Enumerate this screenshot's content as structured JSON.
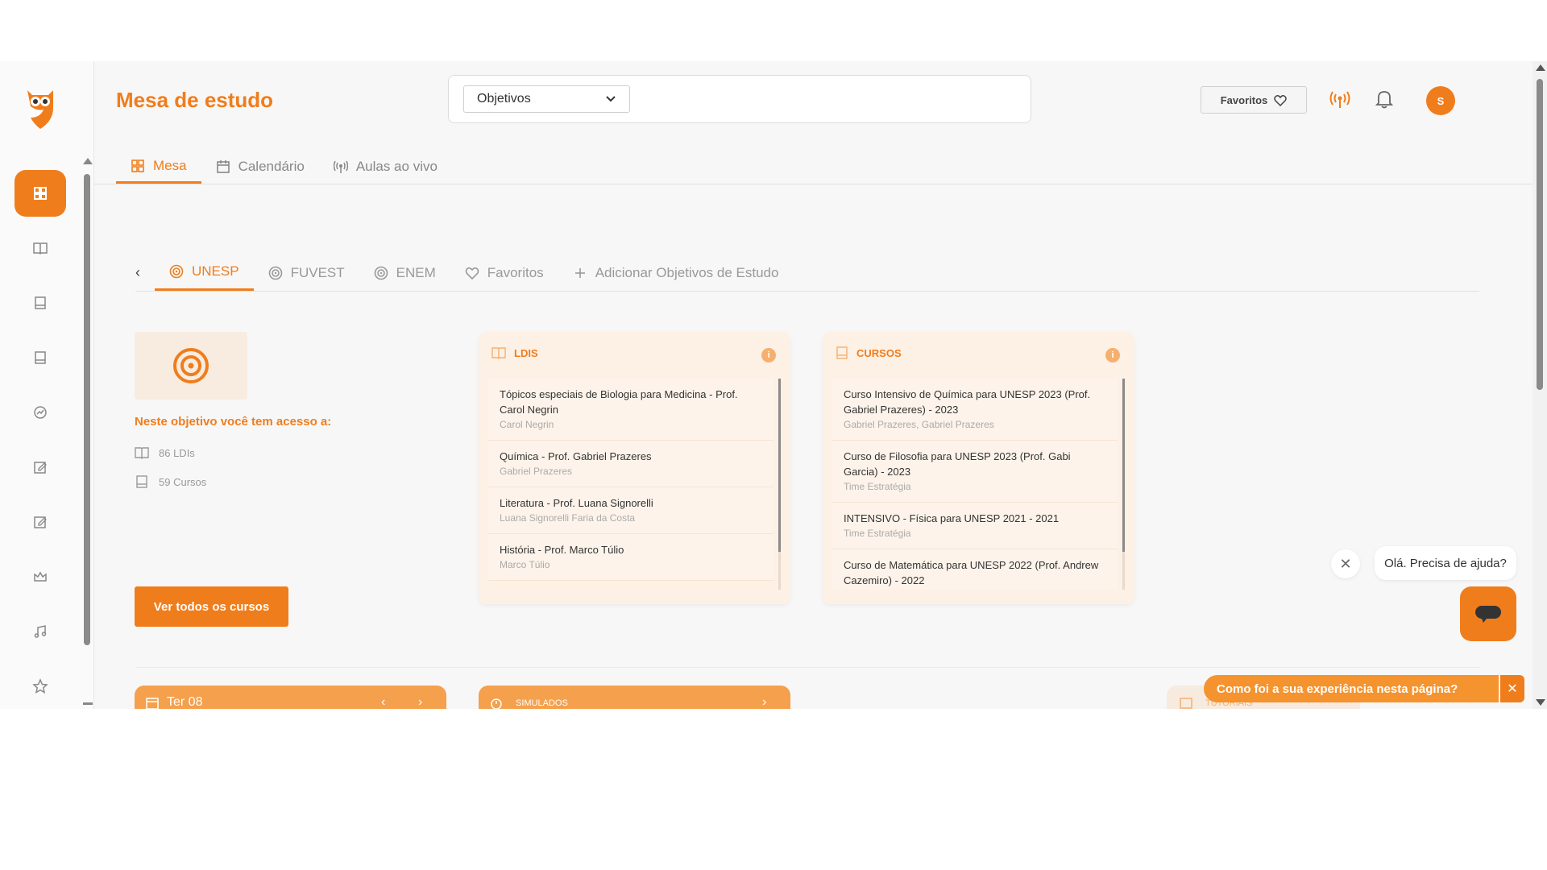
{
  "header": {
    "title": "Mesa de estudo",
    "objetivos_select": "Objetivos",
    "favoritos_label": "Favoritos",
    "avatar_initial": "S"
  },
  "top_tabs": [
    {
      "label": "Mesa",
      "icon": "grid-icon",
      "active": true
    },
    {
      "label": "Calendário",
      "icon": "calendar-icon",
      "active": false
    },
    {
      "label": "Aulas ao vivo",
      "icon": "broadcast-icon",
      "active": false
    }
  ],
  "objective_tabs": [
    {
      "label": "UNESP",
      "icon": "target-icon",
      "active": true
    },
    {
      "label": "FUVEST",
      "icon": "target-icon",
      "active": false
    },
    {
      "label": "ENEM",
      "icon": "target-icon",
      "active": false
    },
    {
      "label": "Favoritos",
      "icon": "heart-icon",
      "active": false
    },
    {
      "label": "Adicionar Objetivos de Estudo",
      "icon": "plus-icon",
      "active": false
    }
  ],
  "objective_info": {
    "access_title": "Neste objetivo você tem acesso a:",
    "ldis_count": "86 LDIs",
    "cursos_count": "59 Cursos",
    "see_all_button": "Ver todos os cursos"
  },
  "ldis_card": {
    "title": "LDIS",
    "items": [
      {
        "title": "Tópicos especiais de Biologia para Medicina - Prof. Carol Negrin",
        "subtitle": "Carol Negrin"
      },
      {
        "title": "Química - Prof. Gabriel Prazeres",
        "subtitle": "Gabriel Prazeres"
      },
      {
        "title": "Literatura - Prof. Luana Signorelli",
        "subtitle": "Luana Signorelli Faria da Costa"
      },
      {
        "title": "História - Prof. Marco Túlio",
        "subtitle": "Marco Túlio"
      }
    ]
  },
  "cursos_card": {
    "title": "CURSOS",
    "items": [
      {
        "title": "Curso Intensivo de Química para UNESP 2023 (Prof. Gabriel Prazeres) - 2023",
        "subtitle": "Gabriel Prazeres, Gabriel Prazeres"
      },
      {
        "title": "Curso de Filosofia para UNESP 2023 (Prof. Gabi Garcia) - 2023",
        "subtitle": "Time Estratégia"
      },
      {
        "title": "INTENSIVO - Física para UNESP 2021 - 2021",
        "subtitle": "Time Estratégia"
      },
      {
        "title": "Curso de Matemática para UNESP 2022 (Prof. Andrew Cazemiro) - 2022",
        "subtitle": ""
      }
    ]
  },
  "bottom_cards": {
    "calendar_day": "Ter 08",
    "simulados": "SIMULADOS",
    "tutoriais": "TUTORIAIS"
  },
  "chat": {
    "bubble_text": "Olá. Precisa de ajuda?",
    "feedback_text": "Como foi a sua experiência nesta página?"
  },
  "colors": {
    "accent": "#f07d1c",
    "card_bg": "#fdf0e4"
  }
}
